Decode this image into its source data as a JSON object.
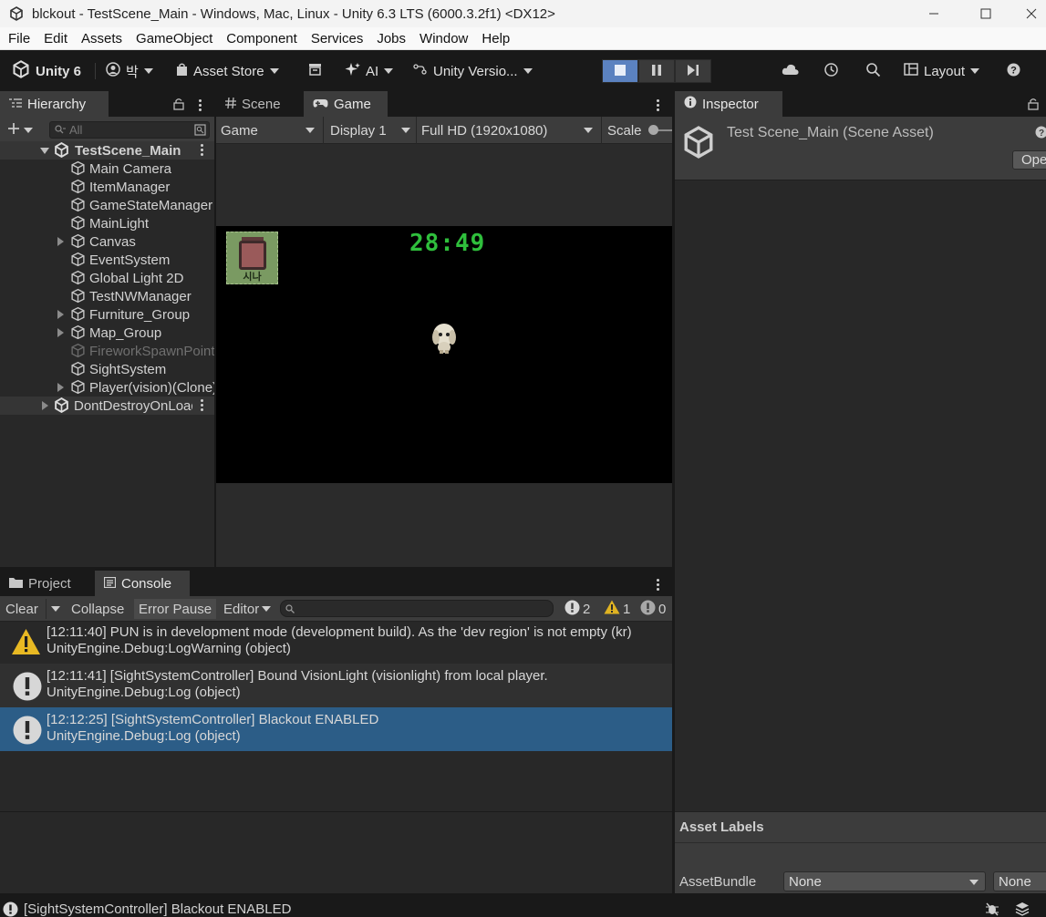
{
  "window": {
    "title": "blckout - TestScene_Main - Windows, Mac, Linux - Unity 6.3 LTS (6000.3.2f1) <DX12>"
  },
  "menu": [
    "File",
    "Edit",
    "Assets",
    "GameObject",
    "Component",
    "Services",
    "Jobs",
    "Window",
    "Help"
  ],
  "toolbar": {
    "unity_label": "Unity 6",
    "account_label": "박",
    "asset_store_label": "Asset Store",
    "ai_label": "AI",
    "version_control_label": "Unity Versio...",
    "layout_label": "Layout"
  },
  "hierarchy": {
    "tab_label": "Hierarchy",
    "search_placeholder": "All",
    "scene_name": "TestScene_Main",
    "items": [
      "Main Camera",
      "ItemManager",
      "GameStateManager",
      "MainLight",
      "Canvas",
      "EventSystem",
      "Global Light 2D",
      "TestNWManager",
      "Furniture_Group",
      "Map_Group",
      "FireworkSpawnPoint",
      "SightSystem",
      "Player(vision)(Clone)"
    ],
    "dont_destroy_label": "DontDestroyOnLoad"
  },
  "center_tabs": {
    "scene_label": "Scene",
    "game_label": "Game"
  },
  "game_toolbar": {
    "view_select": "Game",
    "display_select": "Display 1",
    "resolution_select": "Full HD (1920x1080)",
    "scale_label": "Scale"
  },
  "game": {
    "timer": "28:49",
    "item_label": "시나"
  },
  "inspector": {
    "tab_label": "Inspector",
    "asset_title": "Test Scene_Main (Scene Asset)",
    "open_button": "Ope",
    "asset_labels_header": "Asset Labels",
    "asset_bundle_label": "AssetBundle",
    "asset_bundle_value": "None",
    "asset_variant_value": "None"
  },
  "bottom_tabs": {
    "project_label": "Project",
    "console_label": "Console"
  },
  "console": {
    "clear_label": "Clear",
    "collapse_label": "Collapse",
    "error_pause_label": "Error Pause",
    "editor_label": "Editor",
    "log_count": "2",
    "warning_count": "1",
    "error_count": "0",
    "entries": [
      {
        "line1": "[12:11:40] PUN is in development mode (development build). As the 'dev region' is not empty (kr)",
        "line2": "UnityEngine.Debug:LogWarning (object)"
      },
      {
        "line1": "[12:11:41] [SightSystemController] Bound VisionLight (visionlight) from local player.",
        "line2": "UnityEngine.Debug:Log (object)"
      },
      {
        "line1": "[12:12:25] [SightSystemController] Blackout ENABLED",
        "line2": "UnityEngine.Debug:Log (object)"
      }
    ]
  },
  "status": {
    "message": "[SightSystemController] Blackout ENABLED"
  }
}
